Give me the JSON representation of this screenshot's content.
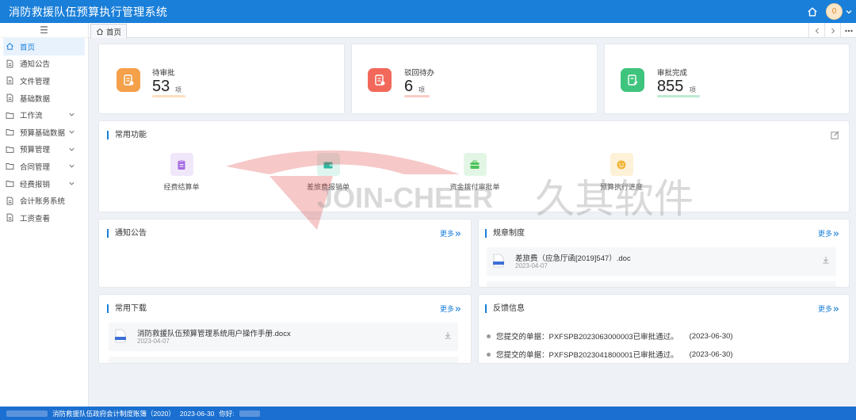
{
  "header": {
    "title": "消防救援队伍预算执行管理系统",
    "notification_count": "0"
  },
  "sidebar": {
    "toggle": "☰",
    "items": [
      {
        "label": "首页",
        "icon": "home-icon",
        "expandable": false,
        "active": true
      },
      {
        "label": "通知公告",
        "icon": "document-icon",
        "expandable": false
      },
      {
        "label": "文件管理",
        "icon": "document-icon",
        "expandable": false
      },
      {
        "label": "基础数据",
        "icon": "document-icon",
        "expandable": false
      },
      {
        "label": "工作流",
        "icon": "folder-icon",
        "expandable": true
      },
      {
        "label": "预算基础数据",
        "icon": "folder-icon",
        "expandable": true
      },
      {
        "label": "预算管理",
        "icon": "folder-icon",
        "expandable": true
      },
      {
        "label": "合同管理",
        "icon": "folder-icon",
        "expandable": true
      },
      {
        "label": "经费报销",
        "icon": "folder-icon",
        "expandable": true
      },
      {
        "label": "会计账务系统",
        "icon": "document-icon",
        "expandable": false
      },
      {
        "label": "工资查看",
        "icon": "document-icon",
        "expandable": false
      }
    ]
  },
  "tabs": {
    "home_tab": "首页"
  },
  "stats": [
    {
      "label": "待审批",
      "value": "53",
      "unit": "项",
      "color": "#f5a04a"
    },
    {
      "label": "驳回待办",
      "value": "6",
      "unit": "项",
      "color": "#f2695c"
    },
    {
      "label": "审批完成",
      "value": "855",
      "unit": "项",
      "color": "#3fc47e"
    }
  ],
  "quick_functions": {
    "title": "常用功能",
    "items": [
      {
        "label": "经费结算单",
        "icon": "clipboard-icon",
        "color": "#a56be0",
        "bg": "#f1e7fb"
      },
      {
        "label": "差旅费报销单",
        "icon": "wallet-icon",
        "color": "#2cb8a0",
        "bg": "#def5f0"
      },
      {
        "label": "资金拨付审批单",
        "icon": "briefcase-icon",
        "color": "#4cc25a",
        "bg": "#e3f6e5"
      },
      {
        "label": "预算执行进度",
        "icon": "smile-icon",
        "color": "#f2b63a",
        "bg": "#fdf1d8"
      }
    ]
  },
  "notices": {
    "title": "通知公告",
    "more": "更多"
  },
  "regulations": {
    "title": "规章制度",
    "more": "更多",
    "files": [
      {
        "name": "差旅费（应急厅函[2019]547）.doc",
        "date": "2023-04-07"
      }
    ]
  },
  "downloads": {
    "title": "常用下载",
    "more": "更多",
    "files": [
      {
        "name": "消防救援队伍预算管理系统用户操作手册.docx",
        "date": "2023-04-07"
      }
    ]
  },
  "feedback": {
    "title": "反馈信息",
    "more": "更多",
    "items": [
      {
        "text": "您提交的单据：PXFSPB2023063000003已审批通过。",
        "date": "(2023-06-30)"
      },
      {
        "text": "您提交的单据：PXFSPB2023041800001已审批通过。",
        "date": "(2023-06-30)"
      }
    ]
  },
  "watermark": {
    "text": "JOIN-CHEER",
    "cn": "久其软件"
  },
  "footer": {
    "org": "消防救援队伍政府会计制度账簿（2020）",
    "date": "2023-06-30",
    "greeting": "你好:"
  }
}
